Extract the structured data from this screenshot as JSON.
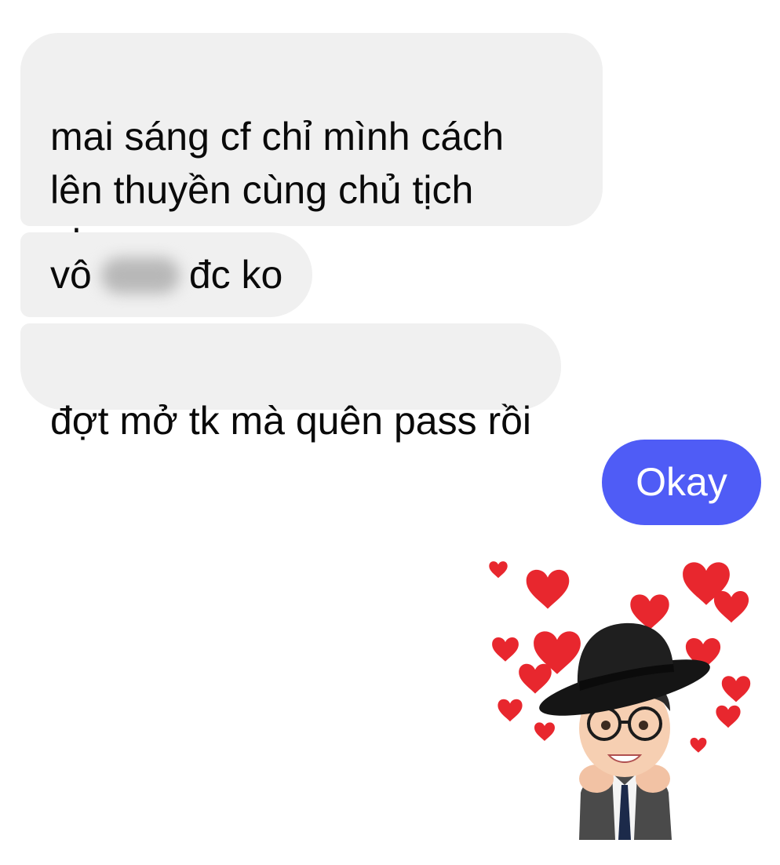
{
  "conversation": {
    "incoming": [
      {
        "text": "mai sáng cf chỉ mình cách\nlên thuyền cùng chủ tịch\nnhe"
      },
      {
        "text_before": "vô",
        "text_after": "đc ko"
      },
      {
        "text": "đợt mở tk mà quên pass rồi"
      }
    ],
    "outgoing": [
      {
        "text": "Okay"
      }
    ],
    "sticker": "avatar-hearts-sticker"
  },
  "colors": {
    "incoming_bubble": "#f0f0f0",
    "outgoing_bubble": "#4f5cf6",
    "heart": "#e8272e"
  }
}
